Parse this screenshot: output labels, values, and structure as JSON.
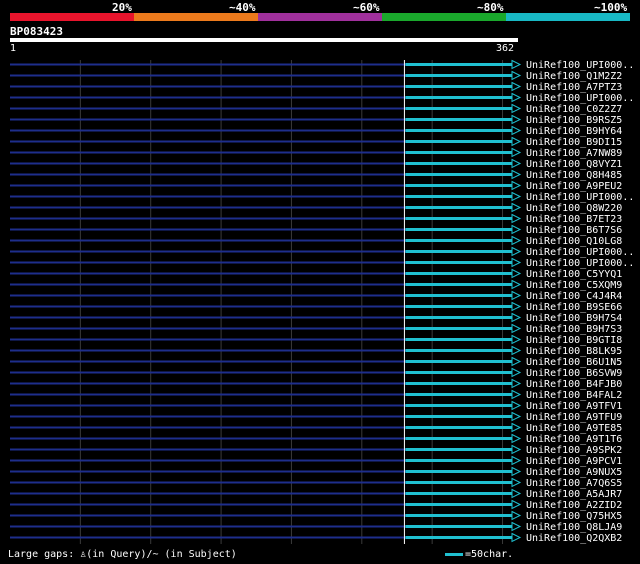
{
  "legend": {
    "labels": [
      "20%",
      "~40%",
      "~60%",
      "~80%",
      "~100%"
    ],
    "colors": [
      "#e8142c",
      "#ec7a1c",
      "#a0309c",
      "#1aa82c",
      "#18b8c4"
    ]
  },
  "query": {
    "name": "BP083423",
    "start": "1",
    "end": "362"
  },
  "hit_color": "#20c0d0",
  "background_line_color": "#1e2e8c",
  "hits": [
    {
      "label": "UniRef100_UPI000..",
      "qstart": 282,
      "qend": 362
    },
    {
      "label": "UniRef100_Q1M2Z2",
      "qstart": 282,
      "qend": 362
    },
    {
      "label": "UniRef100_A7PTZ3",
      "qstart": 282,
      "qend": 362
    },
    {
      "label": "UniRef100_UPI000..",
      "qstart": 282,
      "qend": 362
    },
    {
      "label": "UniRef100_C0Z2Z7",
      "qstart": 282,
      "qend": 362
    },
    {
      "label": "UniRef100_B9RSZ5",
      "qstart": 282,
      "qend": 362
    },
    {
      "label": "UniRef100_B9HY64",
      "qstart": 282,
      "qend": 362
    },
    {
      "label": "UniRef100_B9DI15",
      "qstart": 282,
      "qend": 362
    },
    {
      "label": "UniRef100_A7NW89",
      "qstart": 282,
      "qend": 362
    },
    {
      "label": "UniRef100_Q8VYZ1",
      "qstart": 282,
      "qend": 362
    },
    {
      "label": "UniRef100_Q8H485",
      "qstart": 282,
      "qend": 362
    },
    {
      "label": "UniRef100_A9PEU2",
      "qstart": 282,
      "qend": 362
    },
    {
      "label": "UniRef100_UPI000..",
      "qstart": 282,
      "qend": 362
    },
    {
      "label": "UniRef100_Q8W220",
      "qstart": 282,
      "qend": 362
    },
    {
      "label": "UniRef100_B7ET23",
      "qstart": 282,
      "qend": 362
    },
    {
      "label": "UniRef100_B6T7S6",
      "qstart": 282,
      "qend": 362
    },
    {
      "label": "UniRef100_Q10LG8",
      "qstart": 282,
      "qend": 362
    },
    {
      "label": "UniRef100_UPI000..",
      "qstart": 282,
      "qend": 362
    },
    {
      "label": "UniRef100_UPI000..",
      "qstart": 282,
      "qend": 362
    },
    {
      "label": "UniRef100_C5YYQ1",
      "qstart": 282,
      "qend": 362
    },
    {
      "label": "UniRef100_C5XQM9",
      "qstart": 282,
      "qend": 362
    },
    {
      "label": "UniRef100_C4J4R4",
      "qstart": 282,
      "qend": 362
    },
    {
      "label": "UniRef100_B9SE66",
      "qstart": 282,
      "qend": 362
    },
    {
      "label": "UniRef100_B9H7S4",
      "qstart": 282,
      "qend": 362
    },
    {
      "label": "UniRef100_B9H7S3",
      "qstart": 282,
      "qend": 362
    },
    {
      "label": "UniRef100_B9GTI8",
      "qstart": 282,
      "qend": 362
    },
    {
      "label": "UniRef100_B8LK95",
      "qstart": 282,
      "qend": 362
    },
    {
      "label": "UniRef100_B6U1N5",
      "qstart": 282,
      "qend": 362
    },
    {
      "label": "UniRef100_B6SVW9",
      "qstart": 282,
      "qend": 362
    },
    {
      "label": "UniRef100_B4FJB0",
      "qstart": 282,
      "qend": 362
    },
    {
      "label": "UniRef100_B4FAL2",
      "qstart": 282,
      "qend": 362
    },
    {
      "label": "UniRef100_A9TFV1",
      "qstart": 282,
      "qend": 362
    },
    {
      "label": "UniRef100_A9TFU9",
      "qstart": 282,
      "qend": 362
    },
    {
      "label": "UniRef100_A9TE85",
      "qstart": 282,
      "qend": 362
    },
    {
      "label": "UniRef100_A9T1T6",
      "qstart": 282,
      "qend": 362
    },
    {
      "label": "UniRef100_A9SPK2",
      "qstart": 282,
      "qend": 362
    },
    {
      "label": "UniRef100_A9PCV1",
      "qstart": 282,
      "qend": 362
    },
    {
      "label": "UniRef100_A9NUX5",
      "qstart": 282,
      "qend": 362
    },
    {
      "label": "UniRef100_A7Q6S5",
      "qstart": 282,
      "qend": 362
    },
    {
      "label": "UniRef100_A5AJR7",
      "qstart": 282,
      "qend": 362
    },
    {
      "label": "UniRef100_A2ZID2",
      "qstart": 282,
      "qend": 362
    },
    {
      "label": "UniRef100_Q75HX5",
      "qstart": 282,
      "qend": 362
    },
    {
      "label": "UniRef100_Q8LJA9",
      "qstart": 282,
      "qend": 362
    },
    {
      "label": "UniRef100_Q2QXB2",
      "qstart": 282,
      "qend": 362
    }
  ],
  "footer": {
    "gaps_text": "Large gaps: ♙(in Query)/~ (in Subject)",
    "scale_text": "=50char."
  }
}
